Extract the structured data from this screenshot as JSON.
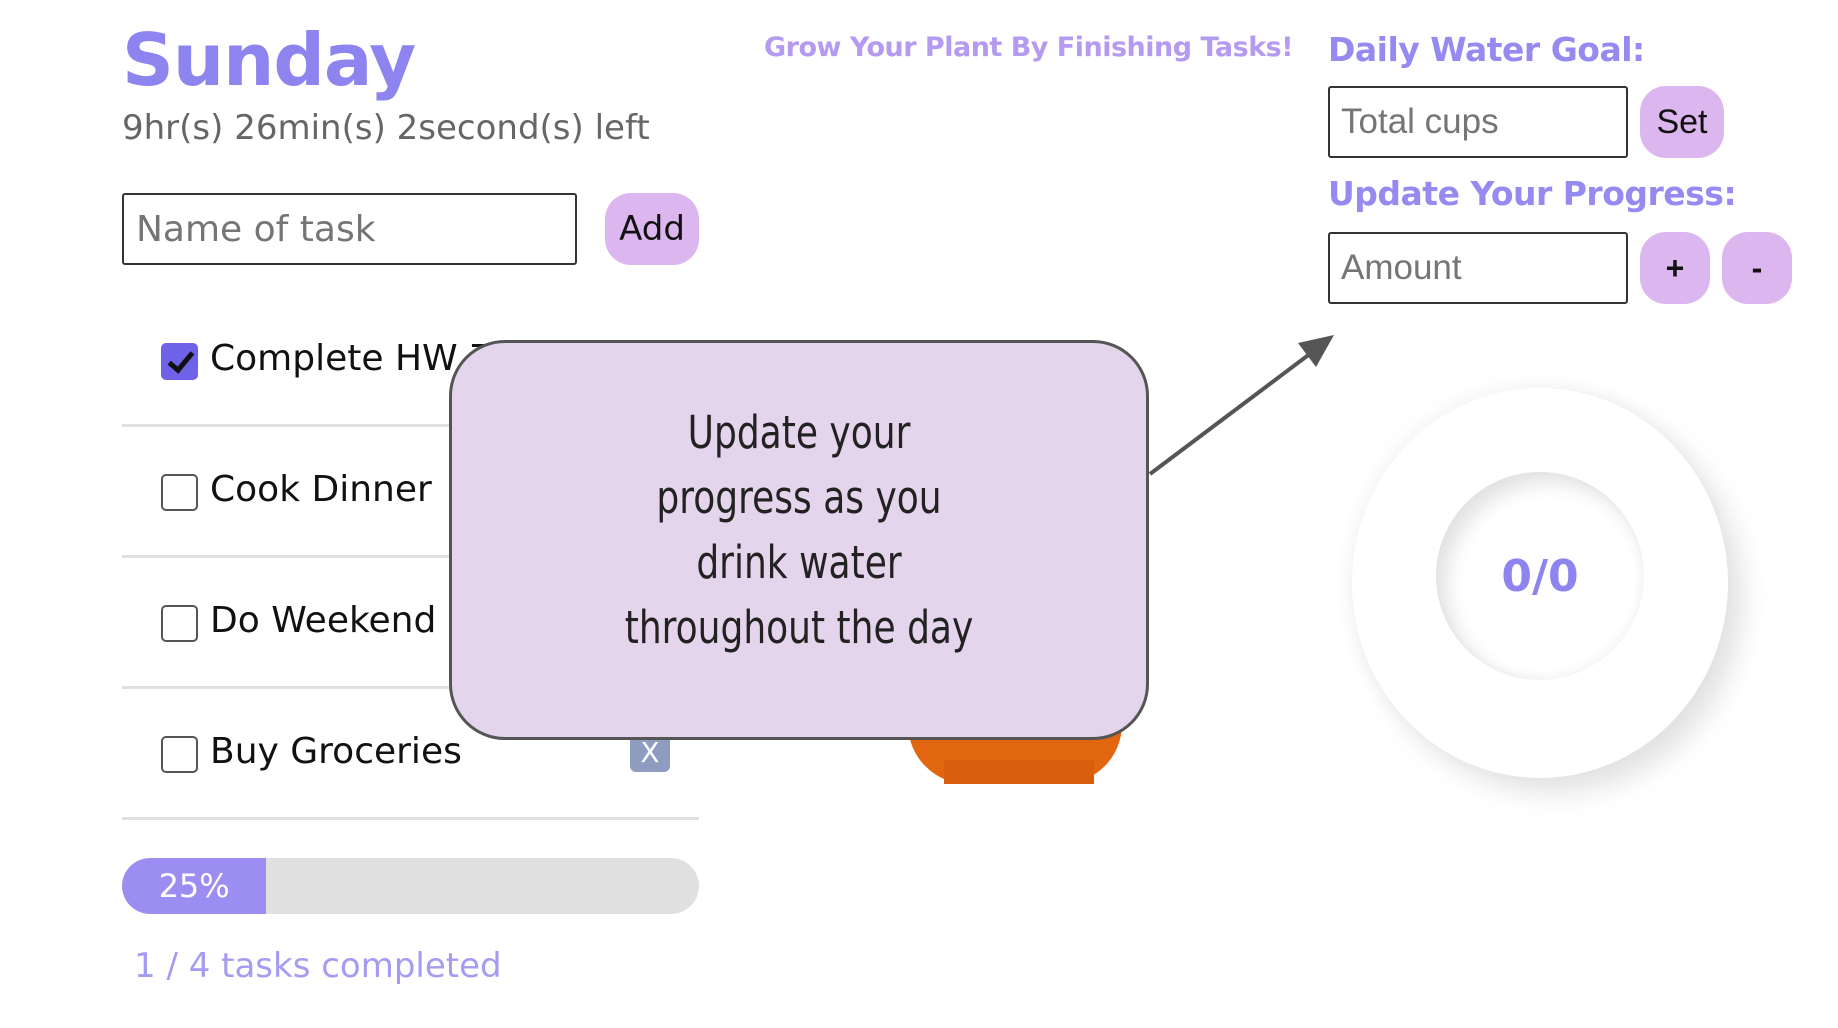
{
  "header": {
    "day": "Sunday",
    "time_left": "9hr(s) 26min(s) 2second(s) left"
  },
  "task_form": {
    "placeholder": "Name of task",
    "add_label": "Add"
  },
  "tasks": [
    {
      "label": "Complete HW 7",
      "checked": true
    },
    {
      "label": "Cook Dinner",
      "checked": false
    },
    {
      "label": "Do Weekend L",
      "checked": false
    },
    {
      "label": "Buy Groceries",
      "checked": false,
      "delete_label": "X"
    }
  ],
  "progress": {
    "percent_label": "25%",
    "value": 0.25,
    "completed_text": "1 / 4 tasks completed"
  },
  "plant": {
    "message": "Grow Your Plant By Finishing Tasks!"
  },
  "water": {
    "goal_label": "Daily Water Goal:",
    "goal_placeholder": "Total cups",
    "set_label": "Set",
    "update_label": "Update Your Progress:",
    "amount_placeholder": "Amount",
    "plus_label": "+",
    "minus_label": "-",
    "count": "0/0"
  },
  "callout": {
    "text": "Update your progress as you drink water throughout the day"
  },
  "colors": {
    "accent": "#8d84f0",
    "button": "#dcb6ee",
    "callout_bg": "#e4d5ec",
    "pot": "#e26510"
  }
}
